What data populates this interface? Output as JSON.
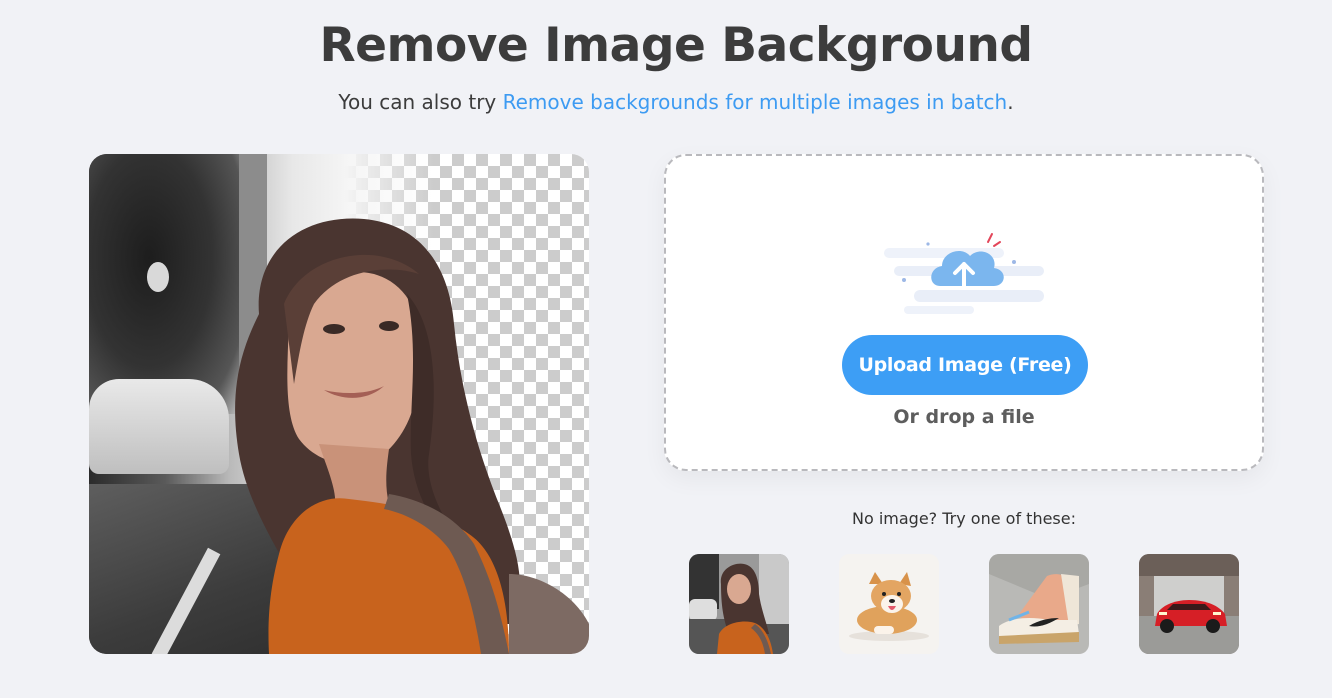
{
  "header": {
    "title": "Remove Image Background",
    "subtitle_prefix": "You can also try ",
    "subtitle_link": "Remove backgrounds for multiple images in batch",
    "subtitle_suffix": "."
  },
  "upload": {
    "button_label": "Upload Image (Free)",
    "drop_text": "Or drop a file",
    "accent_color": "#3d9ef5"
  },
  "samples": {
    "label": "No image? Try one of these:",
    "items": [
      {
        "name": "woman-portrait",
        "icon": "sample-woman-image"
      },
      {
        "name": "corgi-dog",
        "icon": "sample-dog-image"
      },
      {
        "name": "sneaker-shoe",
        "icon": "sample-shoe-image"
      },
      {
        "name": "red-car",
        "icon": "sample-car-image"
      }
    ]
  },
  "colors": {
    "page_background": "#f1f2f6",
    "link": "#3d9bf2",
    "title_text": "#3c3c3c"
  }
}
